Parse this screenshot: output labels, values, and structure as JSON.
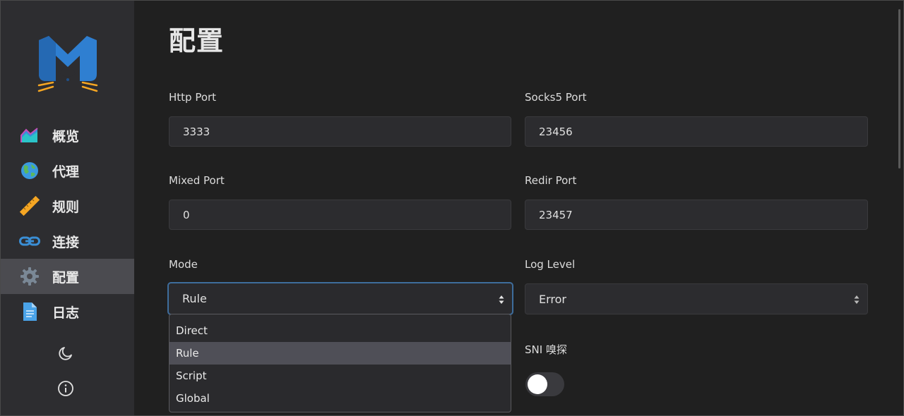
{
  "sidebar": {
    "logo": "mew-cat-logo",
    "items": [
      {
        "label": "概览",
        "icon": "chart-area-icon"
      },
      {
        "label": "代理",
        "icon": "globe-icon"
      },
      {
        "label": "规则",
        "icon": "ruler-icon"
      },
      {
        "label": "连接",
        "icon": "link-icon"
      },
      {
        "label": "配置",
        "icon": "gear-icon",
        "active": true
      },
      {
        "label": "日志",
        "icon": "document-icon"
      }
    ],
    "theme_toggle_icon": "moon-icon",
    "about_icon": "info-icon"
  },
  "page": {
    "title": "配置"
  },
  "fields": {
    "http_port": {
      "label": "Http Port",
      "value": "3333"
    },
    "socks5_port": {
      "label": "Socks5 Port",
      "value": "23456"
    },
    "mixed_port": {
      "label": "Mixed Port",
      "value": "0"
    },
    "redir_port": {
      "label": "Redir Port",
      "value": "23457"
    },
    "mode": {
      "label": "Mode",
      "value": "Rule",
      "options": [
        "Direct",
        "Rule",
        "Script",
        "Global"
      ]
    },
    "log_level": {
      "label": "Log Level",
      "value": "Error"
    },
    "sni": {
      "label": "SNI 嗅探",
      "enabled": false
    }
  },
  "colors": {
    "sidebar_bg": "#2d2d30",
    "main_bg": "#202020",
    "active_item": "#4b4b50",
    "focus_border": "#3e6d9c",
    "logo_blue": "#2f7fd1",
    "logo_orange": "#f5a623"
  }
}
